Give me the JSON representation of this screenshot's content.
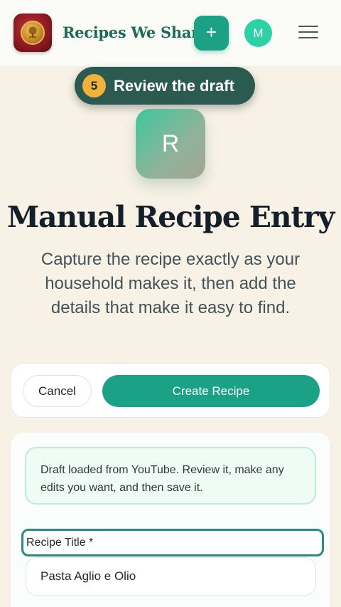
{
  "header": {
    "brand": "Recipes We Share",
    "add_label": "+",
    "avatar_initial": "M"
  },
  "step": {
    "number": "5",
    "label": "Review the draft"
  },
  "badge_letter": "R",
  "page": {
    "title": "Manual Recipe Entry",
    "subtitle": "Capture the recipe exactly as your household makes it, then add the details that make it easy to find."
  },
  "actions": {
    "cancel": "Cancel",
    "create": "Create Recipe"
  },
  "form": {
    "notice": "Draft loaded from YouTube. Review it, make any edits you want, and then save it.",
    "title_label": "Recipe Title *",
    "title_value": "Pasta Aglio e Olio"
  },
  "colors": {
    "accent": "#1aa186",
    "brand_text": "#1d6b57",
    "step_pill": "#2a5a50",
    "step_number": "#f0b23a",
    "background": "#f7f1e6"
  },
  "icons": {
    "logo": "tree-seal-logo",
    "menu": "hamburger-menu-icon"
  }
}
